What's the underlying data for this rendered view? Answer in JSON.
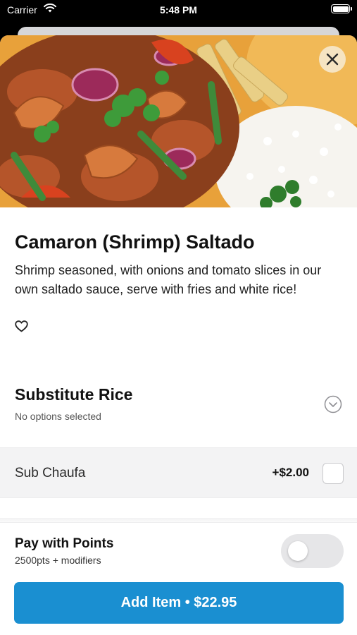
{
  "status_bar": {
    "carrier": "Carrier",
    "time": "5:48 PM",
    "icons": [
      "wifi-icon",
      "battery-icon"
    ]
  },
  "hero": {
    "image": "shrimp-saltado-dish-photo",
    "close_icon": "close-icon"
  },
  "item": {
    "title": "Camaron (Shrimp) Saltado",
    "description": "Shrimp seasoned, with onions and tomato slices in our own saltado sauce, serve with fries and white rice!",
    "favorite_icon": "heart-outline-icon"
  },
  "modifier_group": {
    "title": "Substitute Rice",
    "status": "No options selected",
    "expand_icon": "chevron-down-circle-icon",
    "options": [
      {
        "label": "Sub Chaufa",
        "price": "+$2.00",
        "selected": false
      }
    ]
  },
  "footer": {
    "pay_title": "Pay with Points",
    "pay_subtitle": "2500pts + modifiers",
    "points_toggle_on": false,
    "add_button_label": "Add Item • $22.95"
  },
  "colors": {
    "accent": "#1a8fd1",
    "toggle_off": "#e6e6e8",
    "option_row_bg": "#f3f3f4"
  }
}
